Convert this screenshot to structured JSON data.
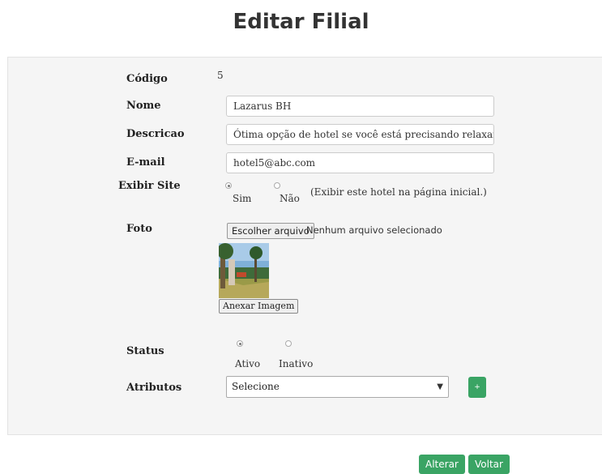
{
  "page": {
    "title": "Editar Filial"
  },
  "form": {
    "codigo": {
      "label": "Código",
      "value": "5"
    },
    "nome": {
      "label": "Nome",
      "value": "Lazarus BH"
    },
    "descricao": {
      "label": "Descricao",
      "value": "Ótima opção de hotel se você está precisando relaxar e descansar."
    },
    "email": {
      "label": "E-mail",
      "value": "hotel5@abc.com"
    },
    "exibir_site": {
      "label": "Exibir Site",
      "options": [
        "Sim",
        "Não"
      ],
      "selected": "Sim",
      "hint": "(Exibir este hotel na página inicial.)"
    },
    "foto": {
      "label": "Foto",
      "choose_button": "Escolher arquivo",
      "no_file_text": "Nenhum arquivo selecionado",
      "attach_button": "Anexar Imagem"
    },
    "status": {
      "label": "Status",
      "options": [
        "Ativo",
        "Inativo"
      ],
      "selected": "Ativo"
    },
    "atributos": {
      "label": "Atributos",
      "selected": "Selecione",
      "add_button": "+"
    }
  },
  "actions": {
    "alterar": "Alterar",
    "voltar": "Voltar"
  },
  "colors": {
    "primary_button": "#3aa464",
    "panel_bg": "#f5f5f5"
  },
  "icons": {
    "select_arrow": "chevron-down-icon",
    "add": "plus-icon"
  }
}
